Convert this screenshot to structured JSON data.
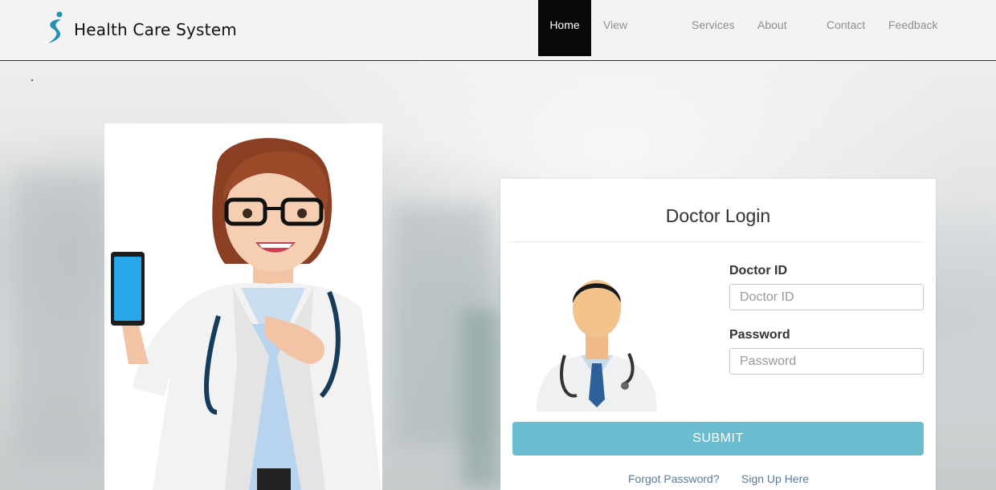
{
  "header": {
    "brand": "Health Care System",
    "logo_icon": "s-logo-icon",
    "nav": [
      {
        "label": "Home",
        "active": true
      },
      {
        "label": "View Doctors",
        "active": false
      },
      {
        "label": "Services",
        "active": false
      },
      {
        "label": "About Us",
        "active": false
      },
      {
        "label": "Contact",
        "active": false
      },
      {
        "label": "Feedback",
        "active": false
      }
    ]
  },
  "illustration": {
    "subject": "female-doctor-with-phone-illustration"
  },
  "login": {
    "title": "Doctor Login",
    "avatar_icon": "doctor-avatar-icon",
    "doctor_id_label": "Doctor ID",
    "doctor_id_placeholder": "Doctor ID",
    "doctor_id_value": "",
    "password_label": "Password",
    "password_placeholder": "Password",
    "password_value": "",
    "submit_label": "SUBMIT",
    "forgot_label": "Forgot Password?",
    "signup_label": "Sign Up Here"
  },
  "colors": {
    "accent": "#6bbccf",
    "active_nav_bg": "#080808",
    "logo_blue": "#2a8fb5"
  }
}
